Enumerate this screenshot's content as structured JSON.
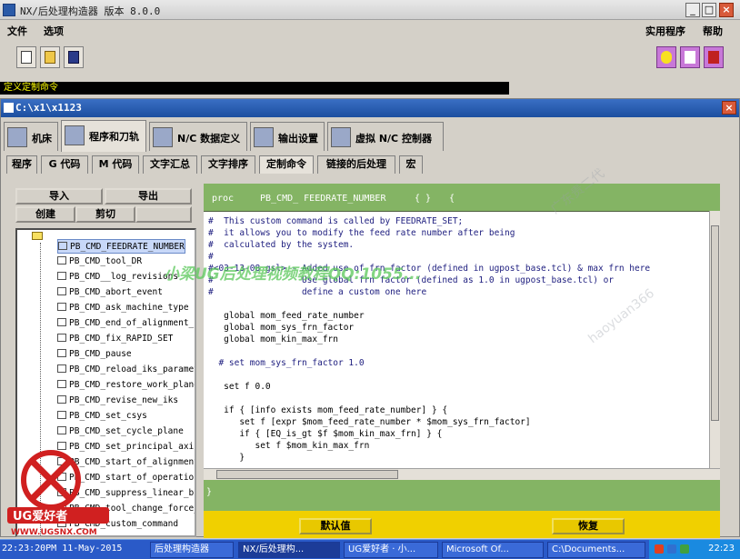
{
  "app": {
    "title": "NX/后处理构造器 版本 8.0.0",
    "menu": [
      "文件",
      "选项",
      "实用程序",
      "帮助"
    ]
  },
  "command_bar": {
    "label": "定义定制命令"
  },
  "subwindow": {
    "title": "C:\\x1\\x1123"
  },
  "main_tabs": [
    {
      "label": "机床",
      "active": false
    },
    {
      "label": "程序和刀轨",
      "active": true
    },
    {
      "label": "N/C 数据定义",
      "active": false
    },
    {
      "label": "输出设置",
      "active": false
    },
    {
      "label": "虚拟 N/C 控制器",
      "active": false
    }
  ],
  "sub_tabs": [
    {
      "label": "程序",
      "active": false
    },
    {
      "label": "G 代码",
      "active": false
    },
    {
      "label": "M 代码",
      "active": false
    },
    {
      "label": "文字汇总",
      "active": false
    },
    {
      "label": "文字排序",
      "active": false
    },
    {
      "label": "定制命令",
      "active": true
    },
    {
      "label": "链接的后处理",
      "active": false
    },
    {
      "label": "宏",
      "active": false
    }
  ],
  "left_panel": {
    "import_label": "导入",
    "export_label": "导出",
    "create_label": "创建",
    "cut_label": "剪切",
    "tree_items": [
      "PB_CMD_FEEDRATE_NUMBER",
      "PB_CMD_tool_DR",
      "PB_CMD__log_revisions",
      "PB_CMD_abort_event",
      "PB_CMD_ask_machine_type",
      "PB_CMD_end_of_alignment_ch",
      "PB_CMD_fix_RAPID_SET",
      "PB_CMD_pause",
      "PB_CMD_reload_iks_paramete",
      "PB_CMD_restore_work_plane_",
      "PB_CMD_revise_new_iks",
      "PB_CMD_set_csys",
      "PB_CMD_set_cycle_plane",
      "PB_CMD_set_principal_axis",
      "PB_CMD_start_of_alignment_",
      "PB_CMD_start_of_operation_",
      "PB_CMD_suppress_linear_blo",
      "PB_CMD_tool_change_force_a",
      "PB_CMD_custom_command"
    ],
    "selected_index": 0
  },
  "editor": {
    "header": {
      "proc": "proc",
      "name": "PB_CMD_ FEEDRATE_NUMBER",
      "braces": "{ }",
      "open": "{"
    },
    "lines": [
      "#  This custom command is called by FEEDRATE_SET;",
      "#  it allows you to modify the feed rate number after being",
      "#  calculated by the system.",
      "#",
      "#<03-13-08 gsl> - Added use of frn factor (defined in ugpost_base.tcl) & max frn here",
      "#                 Use global frn factor (defined as 1.0 in ugpost_base.tcl) or",
      "#                 define a custom one here",
      "",
      "   global mom_feed_rate_number",
      "   global mom_sys_frn_factor",
      "   global mom_kin_max_frn",
      "",
      "  # set mom_sys_frn_factor 1.0",
      "",
      "   set f 0.0",
      "",
      "   if { [info exists mom_feed_rate_number] } {",
      "      set f [expr $mom_feed_rate_number * $mom_sys_frn_factor]",
      "      if { [EQ_is_gt $f $mom_kin_max_frn] } {",
      "         set f $mom_kin_max_frn",
      "      }"
    ],
    "footer": "}"
  },
  "bottom_buttons": {
    "default_label": "默认值",
    "restore_label": "恢复"
  },
  "watermarks": {
    "main": "小梁UG后处理视频教程QQ:1055...",
    "ghost1": "haoyuan366",
    "ghost2": "广东贵二代",
    "logo_text": "UG爱好者",
    "logo_url": "WWW.UGSNX.COM"
  },
  "taskbar": {
    "left_clock": "22:23:20PM 11-May-2015",
    "tasks": [
      "后处理构造器",
      "NX/后处理构...",
      "UG爱好者 · 小...",
      "Microsoft Of...",
      "C:\\Documents..."
    ],
    "active_task": 1,
    "clock": "22:23"
  },
  "colors": {
    "editor_green": "#84b464",
    "yellow_bar": "#f0d000",
    "selection": "#c8d8f8"
  }
}
